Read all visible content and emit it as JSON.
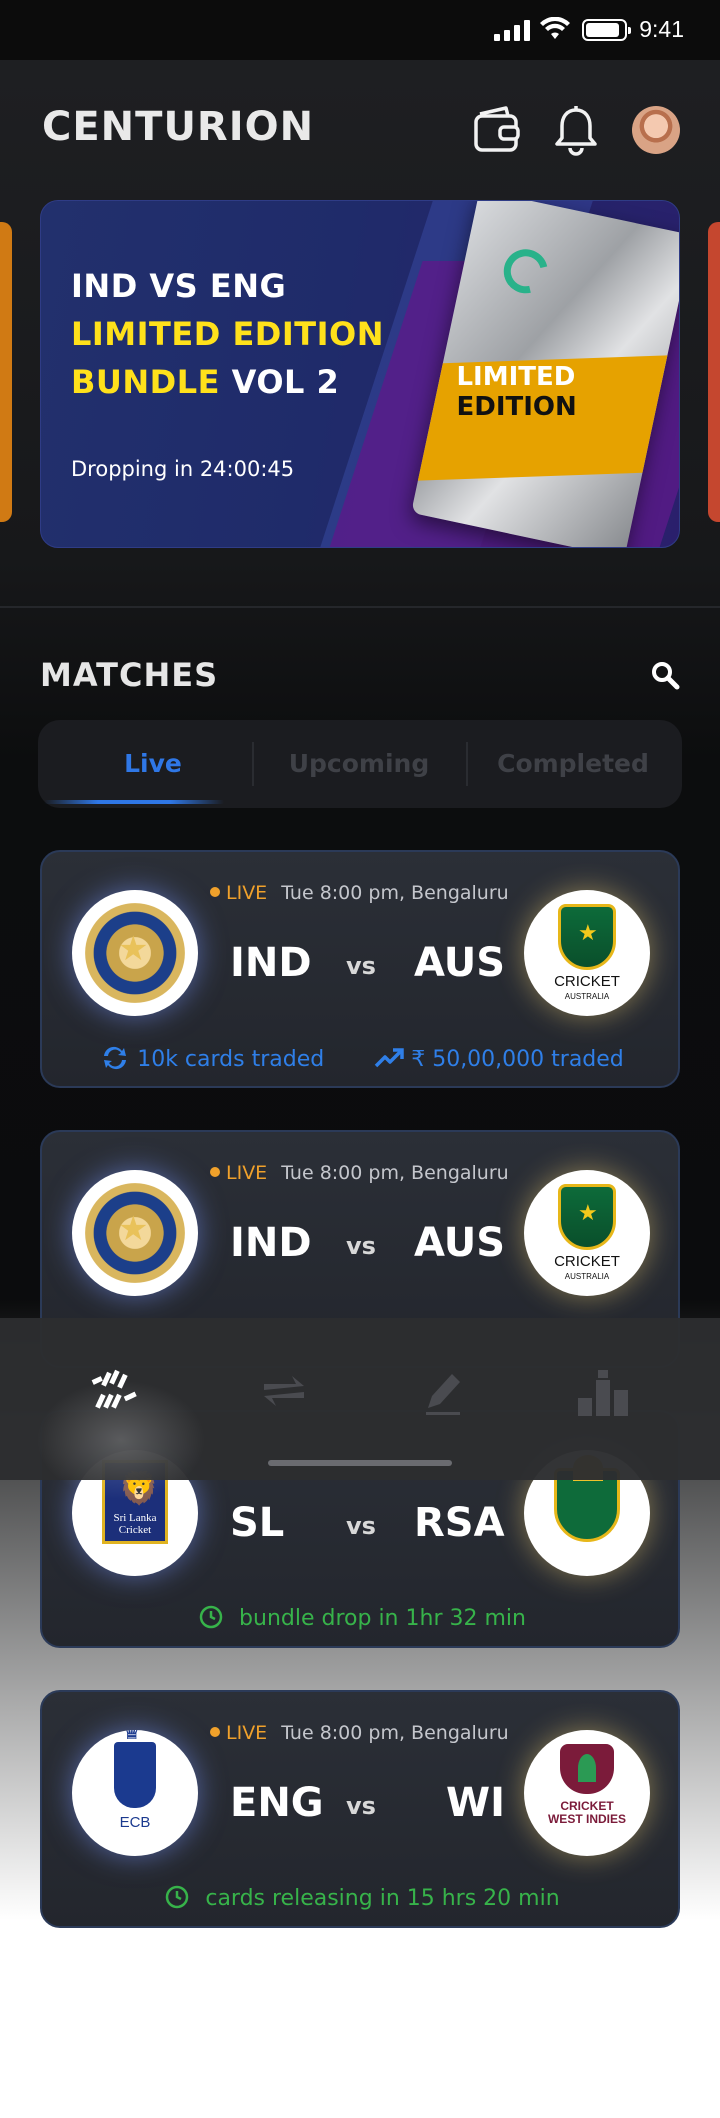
{
  "status_bar": {
    "time": "9:41"
  },
  "header": {
    "brand": "CENTURION",
    "wallet_icon": "wallet-icon",
    "bell_icon": "bell-icon"
  },
  "banner": {
    "line1": "IND VS ENG",
    "line2": "LIMITED EDITION",
    "line3_yellow": "BUNDLE",
    "line3_white": "VOL 2",
    "countdown": "Dropping in 24:00:45",
    "pack_label_1": "LIMITED",
    "pack_label_2": "EDITION"
  },
  "matches": {
    "title": "MATCHES",
    "tabs": [
      {
        "label": "Live",
        "active": true
      },
      {
        "label": "Upcoming",
        "active": false
      },
      {
        "label": "Completed",
        "active": false
      }
    ],
    "vs_label": "vs",
    "cards": [
      {
        "live_tag": "LIVE",
        "time_venue": "Tue 8:00 pm, Bengaluru",
        "team_a": "IND",
        "team_b": "AUS",
        "stat_1": "10k cards traded",
        "stat_2": "₹ 50,00,000 traded"
      },
      {
        "live_tag": "LIVE",
        "time_venue": "Tue 8:00 pm, Bengaluru",
        "team_a": "IND",
        "team_b": "AUS"
      },
      {
        "team_a": "SL",
        "team_b": "RSA",
        "footer": "bundle drop in 1hr 32 min"
      },
      {
        "live_tag": "LIVE",
        "time_venue": "Tue 8:00 pm, Bengaluru",
        "team_a": "ENG",
        "team_b": "WI",
        "footer": "cards releasing in 15 hrs 20 min"
      }
    ],
    "logos": {
      "ca_text": "CRICKET",
      "ca_sub": "AUSTRALIA",
      "sl_text_1": "Sri Lanka",
      "sl_text_2": "Cricket",
      "ecb_text": "ECB",
      "wi_text_1": "CRICKET",
      "wi_text_2": "WEST INDIES"
    }
  },
  "colors": {
    "accent_blue": "#2f77e6",
    "live_orange": "#f0a12b",
    "banner_yellow": "#ffe11b",
    "stat_green": "#37b34a"
  },
  "bottom_nav": [
    "home-icon",
    "trade-icon",
    "edit-icon",
    "leaderboard-icon"
  ]
}
